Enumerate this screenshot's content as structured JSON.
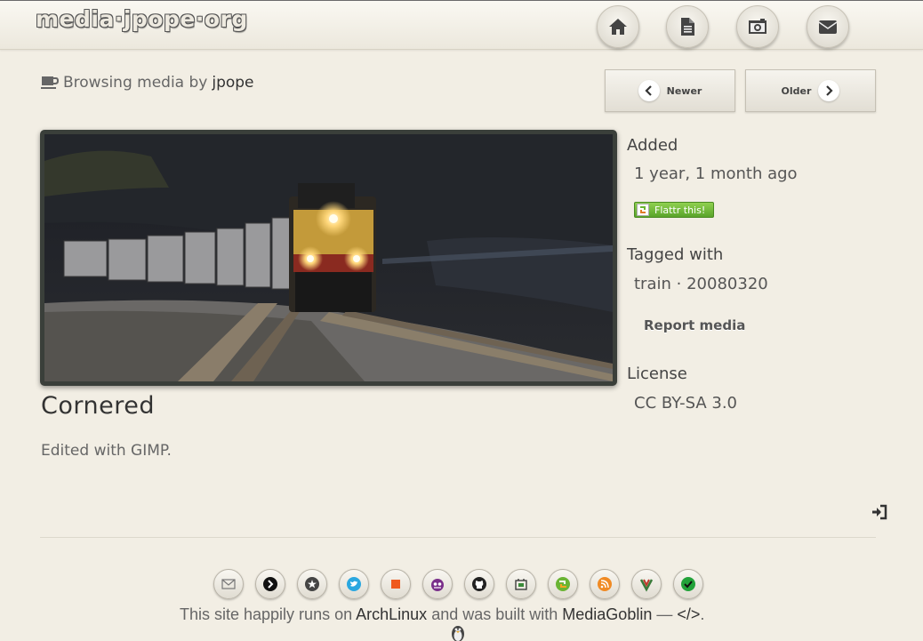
{
  "header": {
    "logo": "media·jpope·org",
    "nav": [
      {
        "name": "home",
        "icon": "home-icon"
      },
      {
        "name": "documents",
        "icon": "document-icon"
      },
      {
        "name": "media",
        "icon": "camera-icon"
      },
      {
        "name": "contact",
        "icon": "envelope-icon"
      }
    ]
  },
  "browsing": {
    "prefix": "Browsing media by",
    "user": "jpope",
    "icon": "coffee-cup-icon"
  },
  "pager": {
    "newer": "Newer",
    "older": "Older"
  },
  "media": {
    "title": "Cornered",
    "description": "Edited with GIMP.",
    "image": "train-photo"
  },
  "sidebar": {
    "added_label": "Added",
    "added_value": "1 year, 1 month ago",
    "flattr_label": "Flattr this!",
    "tagged_label": "Tagged with",
    "tags": [
      "train",
      "20080320"
    ],
    "tag_separator": "·",
    "report_label": "Report media",
    "license_label": "License",
    "license_value": "CC BY-SA 3.0"
  },
  "social": [
    "email-icon",
    "app-net-icon",
    "diaspora-icon",
    "twitter-icon",
    "stack-icon",
    "sourceforge-icon",
    "github-icon",
    "linkedin-icon",
    "flattr-icon",
    "rss-icon",
    "gittip-icon",
    "check-icon"
  ],
  "footer": {
    "text_1": "This site happily runs on",
    "link_1": "ArchLinux",
    "text_2": "and was built with",
    "link_2": "MediaGoblin",
    "text_3": "—",
    "code_symbol": "</>",
    "text_4": "."
  },
  "colors": {
    "background": "#f2eee4",
    "flattr_green": "#6ab434",
    "frame": "#3a3f3a"
  }
}
